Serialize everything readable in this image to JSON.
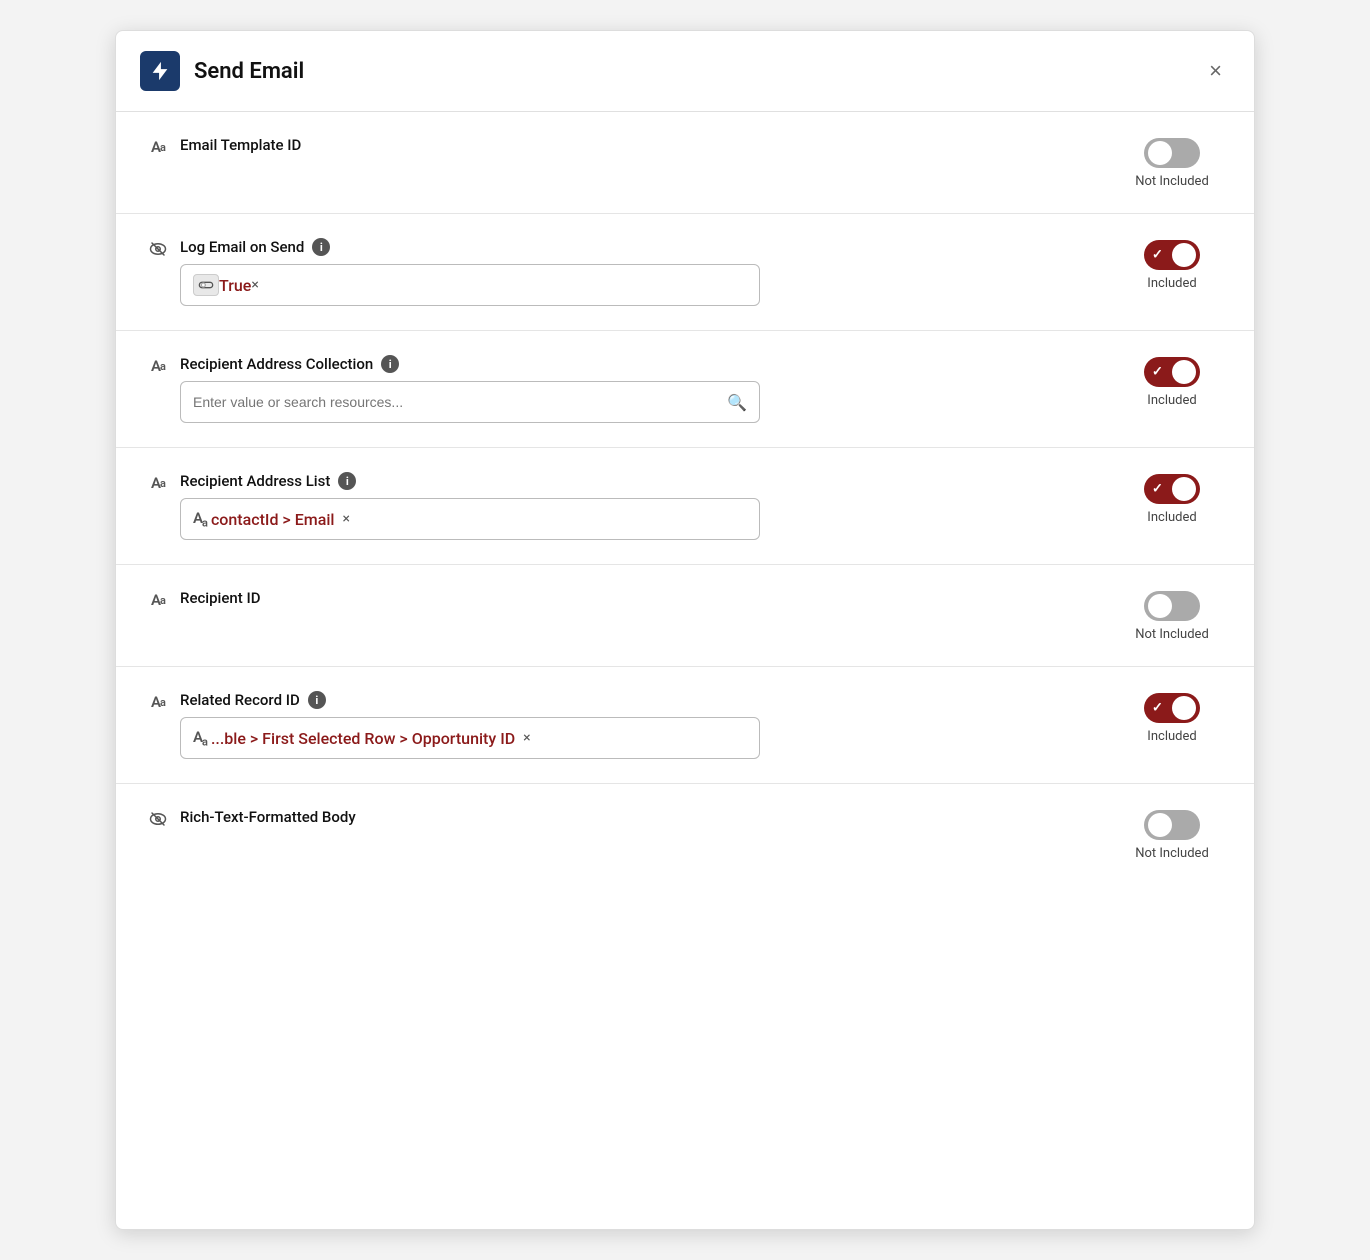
{
  "modal": {
    "title": "Send Email",
    "close_label": "×"
  },
  "fields": [
    {
      "id": "email-template-id",
      "icon_type": "aa",
      "label": "Email Template ID",
      "has_info": false,
      "has_input": false,
      "toggle_state": "off",
      "toggle_label": "Not Included",
      "tag": null,
      "placeholder": null
    },
    {
      "id": "log-email-on-send",
      "icon_type": "eye",
      "label": "Log Email on Send",
      "has_info": true,
      "has_input": true,
      "input_type": "toggle-tag",
      "toggle_state": "on",
      "toggle_label": "Included",
      "tag": {
        "icon": "toggle",
        "text": "True",
        "has_close": true
      }
    },
    {
      "id": "recipient-address-collection",
      "icon_type": "aa",
      "label": "Recipient Address Collection",
      "has_info": true,
      "has_input": true,
      "input_type": "search",
      "toggle_state": "on",
      "toggle_label": "Included",
      "placeholder": "Enter value or search resources..."
    },
    {
      "id": "recipient-address-list",
      "icon_type": "aa",
      "label": "Recipient Address List",
      "has_info": true,
      "has_input": true,
      "input_type": "aa-tag",
      "toggle_state": "on",
      "toggle_label": "Included",
      "tag": {
        "icon": "aa",
        "text": "contactId > Email",
        "has_close": true
      }
    },
    {
      "id": "recipient-id",
      "icon_type": "aa",
      "label": "Recipient ID",
      "has_info": false,
      "has_input": false,
      "toggle_state": "off",
      "toggle_label": "Not Included",
      "tag": null,
      "placeholder": null
    },
    {
      "id": "related-record-id",
      "icon_type": "aa",
      "label": "Related Record ID",
      "has_info": true,
      "has_input": true,
      "input_type": "aa-tag",
      "toggle_state": "on",
      "toggle_label": "Included",
      "tag": {
        "icon": "aa",
        "text": "...ble > First Selected Row > Opportunity ID",
        "has_close": true
      }
    },
    {
      "id": "rich-text-formatted-body",
      "icon_type": "eye",
      "label": "Rich-Text-Formatted Body",
      "has_info": false,
      "has_input": false,
      "toggle_state": "off",
      "toggle_label": "Not Included",
      "tag": null,
      "placeholder": null
    }
  ],
  "labels": {
    "included": "Included",
    "not_included": "Not Included",
    "search_placeholder": "Enter value or search resources...",
    "info_tooltip": "i"
  }
}
